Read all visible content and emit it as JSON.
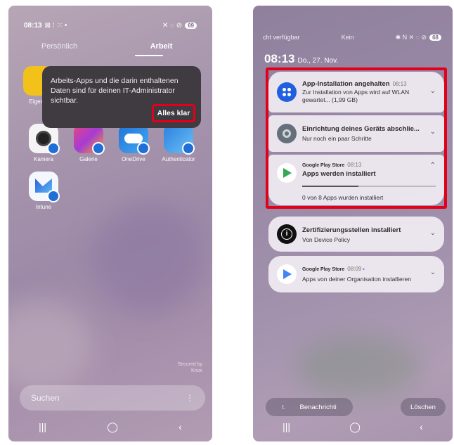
{
  "left_screen": {
    "status": {
      "time": "08:13",
      "icons_left": "⊠ ⁝ ⁙ •",
      "icons_right": "✕ ◌ ⊘",
      "battery": "69"
    },
    "tabs": {
      "personal": "Persönlich",
      "work": "Arbeit"
    },
    "apps": [
      {
        "label": "Kamera"
      },
      {
        "label": "Galerie"
      },
      {
        "label": "OneDrive"
      },
      {
        "label": "Authenticator"
      },
      {
        "label": "Intune"
      }
    ],
    "partial_app_label": "Eigene",
    "tooltip": {
      "text": "Arbeits-Apps und die darin enthaltenen Daten sind für deinen IT-Administrator sichtbar.",
      "button": "Alles klar"
    },
    "secured_by": "Secured by",
    "knox": "Knox",
    "search": {
      "placeholder": "Suchen",
      "menu": "⋮"
    },
    "nav": {
      "recents": "|||",
      "home": "◯",
      "back": "‹"
    }
  },
  "right_screen": {
    "status": {
      "left": "cht verfügbar",
      "middle": "Kein",
      "icons": "✱ N ✕ ◌ ⊘",
      "battery": "68"
    },
    "clock": {
      "time": "08:13",
      "date": "Do., 27. Nov."
    },
    "notifications": [
      {
        "title": "App-Installation angehalten",
        "time": "08:13",
        "body": "Zur Installation von Apps wird auf WLAN gewartet... (1,99 GB)",
        "chevron": "⌄"
      },
      {
        "title": "Einrichtung deines Geräts abschlie...",
        "body": "Nur noch ein paar Schritte",
        "chevron": "⌄"
      },
      {
        "app": "Google Play Store",
        "time": "08:13",
        "title": "Apps werden installiert",
        "progress_text": "0 von 8 Apps wurden installiert",
        "chevron": "⌃"
      },
      {
        "title": "Zertifizierungsstellen installiert",
        "body": "Von Device Policy",
        "chevron": "⌄"
      },
      {
        "app": "Google Play Store",
        "time": "08:09",
        "body": "Apps von deiner Organisation installieren",
        "chevron": "⌄"
      }
    ],
    "buttons": {
      "notif_settings": "Benachrichti",
      "notif_prefix": "t.",
      "clear": "Löschen"
    },
    "nav": {
      "recents": "|||",
      "home": "◯",
      "back": "‹"
    }
  },
  "colors": {
    "highlight": "#e2001a",
    "badge": "#1f6fd6"
  }
}
